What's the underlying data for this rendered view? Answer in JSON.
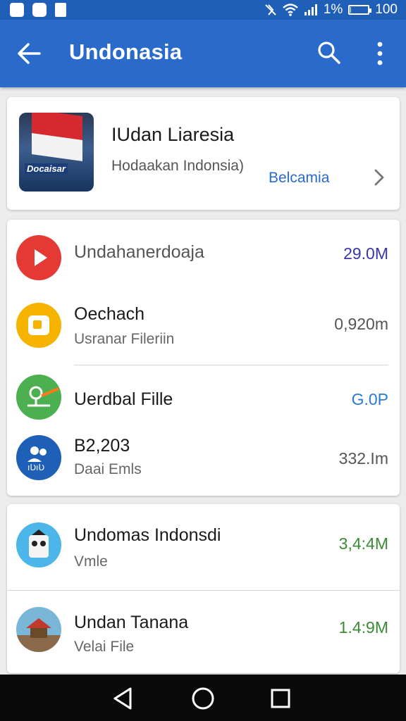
{
  "status_bar": {
    "battery_text": "1%",
    "battery_level": 0.01,
    "time": "100",
    "icons": [
      "notification-icon",
      "sync-icon",
      "sim-icon",
      "mute-icon",
      "wifi-icon",
      "signal-icon",
      "battery-icon"
    ]
  },
  "app_bar": {
    "title": "Undonasia"
  },
  "featured": {
    "title": "IUdan Liaresia",
    "subtitle": "Hodaakan Indonsia)",
    "action_label": "Belcamia",
    "thumb_text": "Docaisar"
  },
  "list1": [
    {
      "name": "Undahanerdoaja",
      "sub": "",
      "size": "29.0M",
      "size_color": "#3a36a8",
      "icon": "play-icon",
      "icon_color": "#e53935"
    },
    {
      "name": "Oechach",
      "sub": "Usranar Fileriin",
      "size": "0,920m",
      "size_color": "#555555",
      "icon": "folder-icon",
      "icon_color": "#f5b300"
    },
    {
      "name": "Uerdbal Fille",
      "sub": "",
      "size": "G.0P",
      "size_color": "#2a7ad6",
      "icon": "map-pin-icon",
      "icon_color": "#4caf50"
    },
    {
      "name": "B2,203",
      "sub": "Daai Emls",
      "size": "332.Im",
      "size_color": "#555555",
      "icon": "people-icon",
      "icon_color": "#1e5fb8"
    }
  ],
  "list2": [
    {
      "name": "Undomas Indonsdi",
      "sub": "Vmle",
      "size": "3,4:4M",
      "size_color": "#3a8a34",
      "icon": "robot-icon",
      "icon_color": "#4db6e8"
    },
    {
      "name": "Undan Tanana",
      "sub": "Velai File",
      "size": "1.4:9M",
      "size_color": "#3a8a34",
      "icon": "landmark-icon",
      "icon_color": "#7ab6d8"
    }
  ],
  "nav": {
    "back": "back-nav-icon",
    "home": "home-nav-icon",
    "recents": "recents-nav-icon"
  }
}
